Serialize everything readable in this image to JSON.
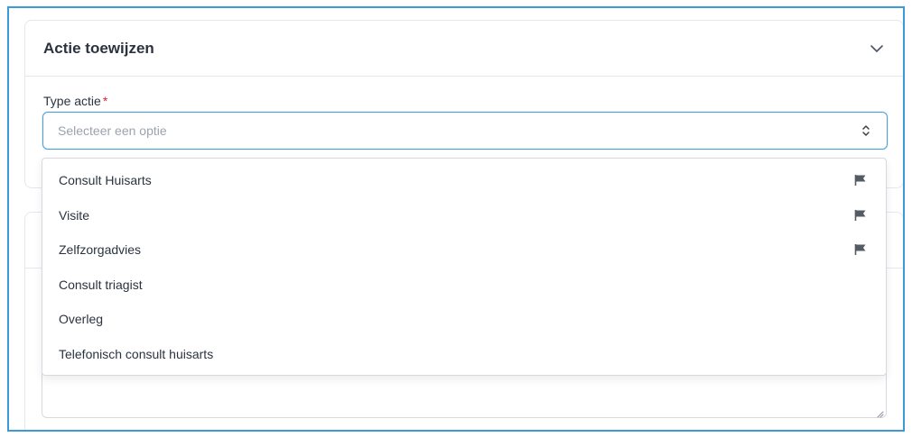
{
  "card": {
    "title": "Actie toewijzen"
  },
  "field": {
    "label": "Type actie",
    "required_mark": "*",
    "placeholder": "Selecteer een optie"
  },
  "dropdown": {
    "options": [
      {
        "label": "Consult Huisarts",
        "icon": "flag-icon"
      },
      {
        "label": "Visite",
        "icon": "flag-icon"
      },
      {
        "label": "Zelfzorgadvies",
        "icon": "flag-icon"
      },
      {
        "label": "Consult triagist"
      },
      {
        "label": "Overleg"
      },
      {
        "label": "Telefonisch consult huisarts"
      }
    ]
  },
  "colors": {
    "focus_border": "#4a9fd8",
    "required": "#d9263a",
    "frame_border": "#3d9ad9",
    "flag": "#555b63"
  }
}
